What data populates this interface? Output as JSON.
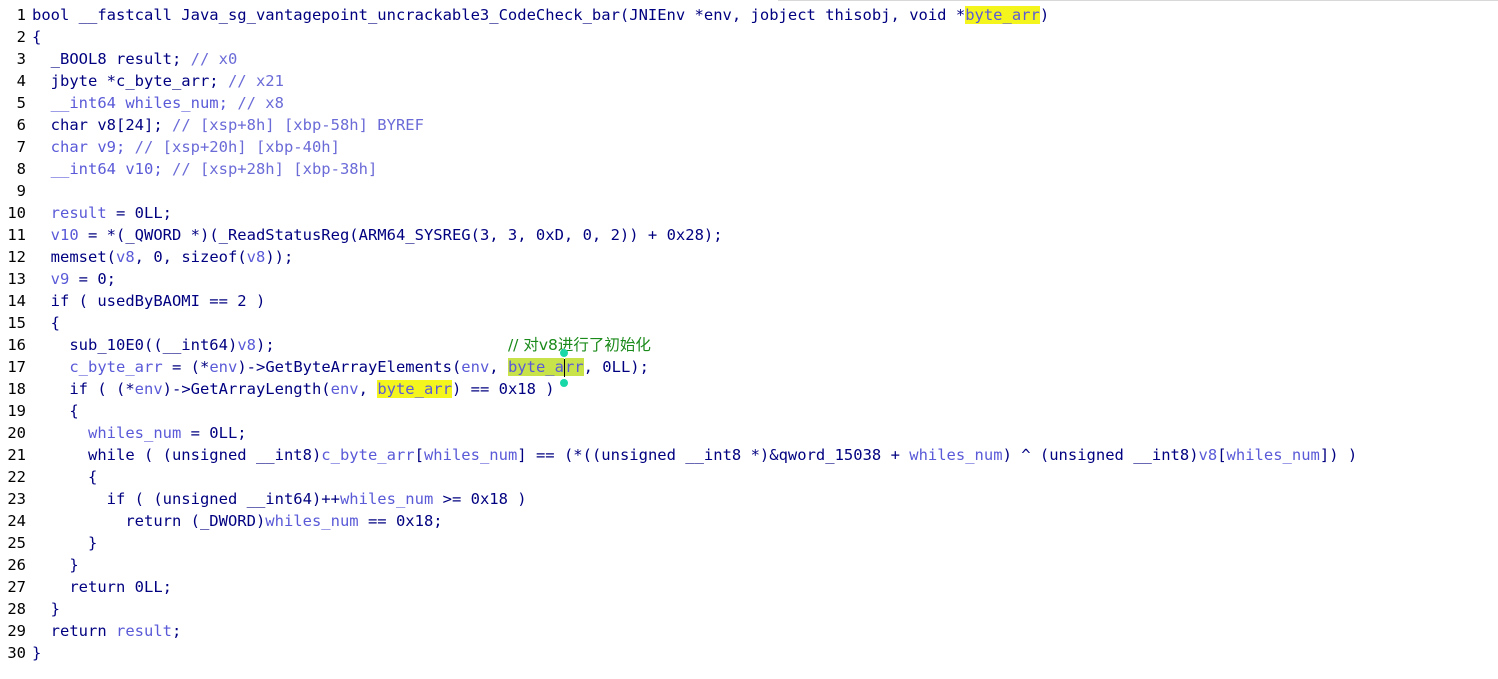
{
  "editor": {
    "lines": [
      {
        "num": "1",
        "parts": [
          {
            "t": "bool __fastcall Java_sg_vantagepoint_uncrackable3_CodeCheck_bar(JNIEnv *env, jobject thisobj, void *",
            "c": "plain"
          },
          {
            "t": "byte_arr",
            "c": "hl-head"
          },
          {
            "t": ")",
            "c": "plain"
          }
        ]
      },
      {
        "num": "2",
        "parts": [
          {
            "t": "{",
            "c": "plain"
          }
        ]
      },
      {
        "num": "3",
        "decl": true,
        "parts": [
          {
            "t": "  _BOOL8 result; ",
            "c": "plain"
          },
          {
            "t": "// x0",
            "c": "cmt"
          }
        ]
      },
      {
        "num": "4",
        "decl": true,
        "parts": [
          {
            "t": "  jbyte *c_byte_arr; ",
            "c": "plain"
          },
          {
            "t": "// x21",
            "c": "cmt"
          }
        ]
      },
      {
        "num": "5",
        "decl": true,
        "parts": [
          {
            "t": "  __int64 whiles_num; ",
            "c": "var"
          },
          {
            "t": "// x8",
            "c": "cmt"
          }
        ]
      },
      {
        "num": "6",
        "decl": true,
        "parts": [
          {
            "t": "  char v8[24]; ",
            "c": "plain"
          },
          {
            "t": "// [xsp+8h] [xbp-58h] BYREF",
            "c": "cmt"
          }
        ]
      },
      {
        "num": "7",
        "decl": true,
        "parts": [
          {
            "t": "  char v9; ",
            "c": "var"
          },
          {
            "t": "// [xsp+20h] [xbp-40h]",
            "c": "cmt"
          }
        ]
      },
      {
        "num": "8",
        "decl": true,
        "parts": [
          {
            "t": "  __int64 v10; ",
            "c": "var"
          },
          {
            "t": "// [xsp+28h] [xbp-38h]",
            "c": "cmt"
          }
        ]
      },
      {
        "num": "9",
        "parts": [
          {
            "t": "",
            "c": "plain"
          }
        ]
      },
      {
        "num": "10",
        "parts": [
          {
            "t": "  result",
            "c": "var"
          },
          {
            "t": " = 0LL;",
            "c": "plain"
          }
        ]
      },
      {
        "num": "11",
        "parts": [
          {
            "t": "  v10",
            "c": "var"
          },
          {
            "t": " = *(_QWORD *)(_ReadStatusReg(ARM64_SYSREG(3, 3, 0xD, 0, 2)) + 0x28);",
            "c": "plain"
          }
        ]
      },
      {
        "num": "12",
        "parts": [
          {
            "t": "  memset(",
            "c": "plain"
          },
          {
            "t": "v8",
            "c": "var"
          },
          {
            "t": ", 0, sizeof(",
            "c": "plain"
          },
          {
            "t": "v8",
            "c": "var"
          },
          {
            "t": "));",
            "c": "plain"
          }
        ]
      },
      {
        "num": "13",
        "parts": [
          {
            "t": "  v9",
            "c": "var"
          },
          {
            "t": " = 0;",
            "c": "plain"
          }
        ]
      },
      {
        "num": "14",
        "parts": [
          {
            "t": "  if ( usedByBAOMI == 2 )",
            "c": "plain"
          }
        ]
      },
      {
        "num": "15",
        "parts": [
          {
            "t": "  {",
            "c": "plain"
          }
        ]
      },
      {
        "num": "16",
        "parts": [
          {
            "t": "    sub_10E0((__int64)",
            "c": "plain"
          },
          {
            "t": "v8",
            "c": "var"
          },
          {
            "t": ");                         ",
            "c": "plain"
          },
          {
            "t": "// ",
            "c": "cmt-cn"
          },
          {
            "t": "对v8进行了初始化",
            "c": "cmt-cn"
          }
        ]
      },
      {
        "num": "17",
        "current": true,
        "parts": [
          {
            "t": "    c_byte_arr",
            "c": "var"
          },
          {
            "t": " = (*",
            "c": "plain"
          },
          {
            "t": "env",
            "c": "var"
          },
          {
            "t": ")->GetByteArrayElements(",
            "c": "plain"
          },
          {
            "t": "env",
            "c": "var"
          },
          {
            "t": ", ",
            "c": "plain"
          },
          {
            "t": "byte_a",
            "c": "hl hl-cur"
          },
          {
            "t": "|",
            "c": "cursor"
          },
          {
            "t": "rr",
            "c": "hl hl-cur"
          },
          {
            "t": ", 0LL);",
            "c": "plain"
          }
        ]
      },
      {
        "num": "18",
        "parts": [
          {
            "t": "    if ( (*",
            "c": "plain"
          },
          {
            "t": "env",
            "c": "var"
          },
          {
            "t": ")->GetArrayLength(",
            "c": "plain"
          },
          {
            "t": "env",
            "c": "var"
          },
          {
            "t": ", ",
            "c": "plain"
          },
          {
            "t": "byte_arr",
            "c": "hl"
          },
          {
            "t": ") == 0x18 )",
            "c": "plain"
          }
        ]
      },
      {
        "num": "19",
        "parts": [
          {
            "t": "    {",
            "c": "plain"
          }
        ]
      },
      {
        "num": "20",
        "parts": [
          {
            "t": "      whiles_num",
            "c": "var"
          },
          {
            "t": " = 0LL;",
            "c": "plain"
          }
        ]
      },
      {
        "num": "21",
        "parts": [
          {
            "t": "      while ( (unsigned __int8)",
            "c": "plain"
          },
          {
            "t": "c_byte_arr",
            "c": "var"
          },
          {
            "t": "[",
            "c": "plain"
          },
          {
            "t": "whiles_num",
            "c": "var"
          },
          {
            "t": "] == (*((unsigned __int8 *)&qword_15038 + ",
            "c": "plain"
          },
          {
            "t": "whiles_num",
            "c": "var"
          },
          {
            "t": ") ^ (unsigned __int8)",
            "c": "plain"
          },
          {
            "t": "v8",
            "c": "var"
          },
          {
            "t": "[",
            "c": "plain"
          },
          {
            "t": "whiles_num",
            "c": "var"
          },
          {
            "t": "]) )",
            "c": "plain"
          }
        ]
      },
      {
        "num": "22",
        "parts": [
          {
            "t": "      {",
            "c": "plain"
          }
        ]
      },
      {
        "num": "23",
        "parts": [
          {
            "t": "        if ( (unsigned __int64)++",
            "c": "plain"
          },
          {
            "t": "whiles_num",
            "c": "var"
          },
          {
            "t": " >= 0x18 )",
            "c": "plain"
          }
        ]
      },
      {
        "num": "24",
        "parts": [
          {
            "t": "          return (_DWORD)",
            "c": "plain"
          },
          {
            "t": "whiles_num",
            "c": "var"
          },
          {
            "t": " == 0x18;",
            "c": "plain"
          }
        ]
      },
      {
        "num": "25",
        "parts": [
          {
            "t": "      }",
            "c": "plain"
          }
        ]
      },
      {
        "num": "26",
        "parts": [
          {
            "t": "    }",
            "c": "plain"
          }
        ]
      },
      {
        "num": "27",
        "parts": [
          {
            "t": "    return 0LL;",
            "c": "plain"
          }
        ]
      },
      {
        "num": "28",
        "parts": [
          {
            "t": "  }",
            "c": "plain"
          }
        ]
      },
      {
        "num": "29",
        "parts": [
          {
            "t": "  return ",
            "c": "plain"
          },
          {
            "t": "result",
            "c": "var"
          },
          {
            "t": ";",
            "c": "plain"
          }
        ]
      },
      {
        "num": "30",
        "parts": [
          {
            "t": "}",
            "c": "plain"
          }
        ]
      }
    ]
  },
  "colors": {
    "background": "#ffffff",
    "code": "#000080",
    "variable": "#5a5ad8",
    "decl_bg": "#e6fbfb",
    "current_line_bg": "#c1e6c3",
    "highlight": "#f5f51e",
    "comment_cn": "#1a8a1a"
  }
}
